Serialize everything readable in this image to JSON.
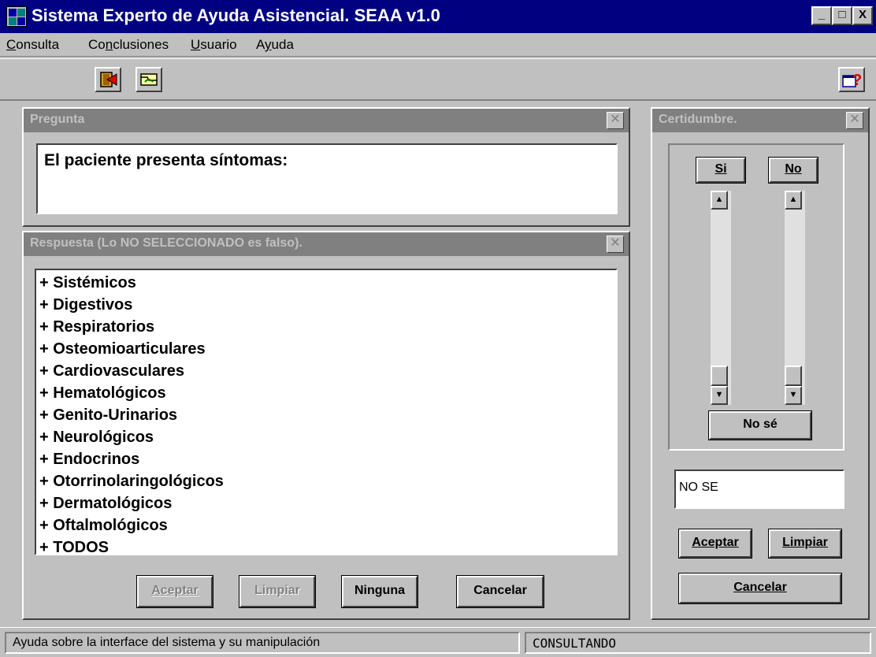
{
  "window": {
    "title": "Sistema Experto de Ayuda Asistencial. SEAA v1.0",
    "controls": {
      "minimize": "_",
      "maximize": "□",
      "close": "X"
    }
  },
  "menu": [
    {
      "label": "Consulta",
      "underline_index": 0
    },
    {
      "label": "Conclusiones",
      "underline_index": 2
    },
    {
      "label": "Usuario",
      "underline_index": 0
    },
    {
      "label": "Ayuda",
      "underline_index": 1
    }
  ],
  "toolbar": {
    "icons": [
      "exit-icon",
      "open-folder-icon",
      "help-icon"
    ]
  },
  "pregunta": {
    "title": "Pregunta",
    "text": "El paciente presenta síntomas:"
  },
  "respuesta": {
    "title": "Respuesta (Lo NO SELECCIONADO es falso).",
    "options": [
      "+ Sistémicos",
      "+ Digestivos",
      "+ Respiratorios",
      "+ Osteomioarticulares",
      "+ Cardiovasculares",
      "+ Hematológicos",
      "+ Genito-Urinarios",
      "+ Neurológicos",
      "+ Endocrinos",
      "+ Otorrinolaringológicos",
      "+ Dermatológicos",
      "+ Oftalmológicos",
      "+ TODOS"
    ],
    "buttons": {
      "aceptar": "Aceptar",
      "limpiar": "Limpiar",
      "ninguna": "Ninguna",
      "cancelar": "Cancelar"
    }
  },
  "certidumbre": {
    "title": "Certidumbre.",
    "si": "Si",
    "no": "No",
    "nose": "No sé",
    "si_level": 0,
    "no_level": 0,
    "value": "NO SE",
    "buttons": {
      "aceptar": "Aceptar",
      "limpiar": "Limpiar",
      "cancelar": "Cancelar"
    }
  },
  "status": {
    "help": "Ayuda sobre la interface del sistema y su manipulación",
    "state": "CONSULTANDO"
  },
  "colors": {
    "titlebar": "#000080",
    "panel_header": "#808080",
    "face": "#c0c0c0"
  }
}
